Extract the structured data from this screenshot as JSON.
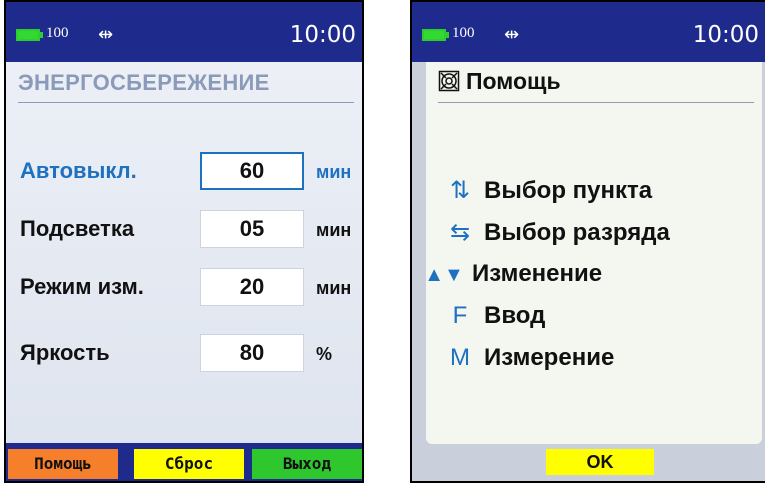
{
  "status": {
    "battery_level": "100",
    "usb_icon": "usb-icon",
    "time": "10:00"
  },
  "left": {
    "title": "ЭНЕРГОСБЕРЕЖЕНИЕ",
    "rows": [
      {
        "label": "Автовыкл.",
        "value": "60",
        "unit": "мин",
        "selected": true
      },
      {
        "label": "Подсветка",
        "value": "05",
        "unit": "мин",
        "selected": false
      },
      {
        "label": "Режим изм.",
        "value": "20",
        "unit": "мин",
        "selected": false
      },
      {
        "label": "Яркость",
        "value": "80",
        "unit": "%",
        "selected": false
      }
    ],
    "softkeys": [
      {
        "label": "Помощь",
        "color": "#f57f2a"
      },
      {
        "label": "Сброс",
        "color": "#ffff00"
      },
      {
        "label": "Выход",
        "color": "#2ec82e"
      }
    ]
  },
  "right": {
    "title": "Помощь",
    "items": [
      {
        "symbol": "⇅",
        "text": "Выбор пункта"
      },
      {
        "symbol": "⇆",
        "text": "Выбор разряда"
      },
      {
        "symbol": "▲▼",
        "text": "Изменение"
      },
      {
        "symbol": "F",
        "text": "Ввод"
      },
      {
        "symbol": "M",
        "text": "Измерение"
      }
    ],
    "ok_label": "OK"
  },
  "colors": {
    "status_bar": "#1e2a8c",
    "accent": "#1e70c0",
    "ok_button": "#ffff00"
  }
}
